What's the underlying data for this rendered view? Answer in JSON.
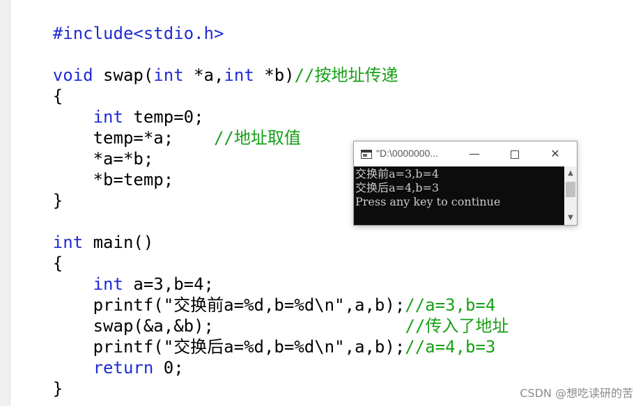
{
  "code": {
    "lines": [
      [
        "#include<stdio.h>"
      ],
      [
        ""
      ],
      [
        "void",
        " swap(",
        "int",
        " *a,",
        "int",
        " *b)",
        "//按地址传递"
      ],
      [
        "{"
      ],
      [
        "    ",
        "int",
        " temp=0;"
      ],
      [
        "    temp=*a;    ",
        "//地址取值"
      ],
      [
        "    *a=*b;"
      ],
      [
        "    *b=temp;"
      ],
      [
        "}"
      ],
      [
        ""
      ],
      [
        "int",
        " main()"
      ],
      [
        "{"
      ],
      [
        "    ",
        "int",
        " a=3,b=4;"
      ],
      [
        "    printf(\"交换前a=%d,b=%d\\n\",a,b);",
        "//a=3,b=4"
      ],
      [
        "    swap(&a,&b);                   ",
        "//传入了地址"
      ],
      [
        "    printf(\"交换后a=%d,b=%d\\n\",a,b);",
        "//a=4,b=3"
      ],
      [
        "    ",
        "return",
        " 0;"
      ],
      [
        "}"
      ]
    ]
  },
  "console": {
    "title": "\"D:\\0000000...",
    "minimize_glyph": "—",
    "close_glyph": "✕",
    "output": [
      "交换前a=3,b=4",
      "交换后a=4,b=3",
      "Press any key to continue"
    ],
    "scroll_up_glyph": "▲",
    "scroll_down_glyph": "▼"
  },
  "watermark": "CSDN @想吃读研的苦",
  "colors": {
    "keyword": "#1f2bd4",
    "comment": "#16a016",
    "console_bg": "#0c0c0c",
    "console_text": "#cccccc"
  }
}
